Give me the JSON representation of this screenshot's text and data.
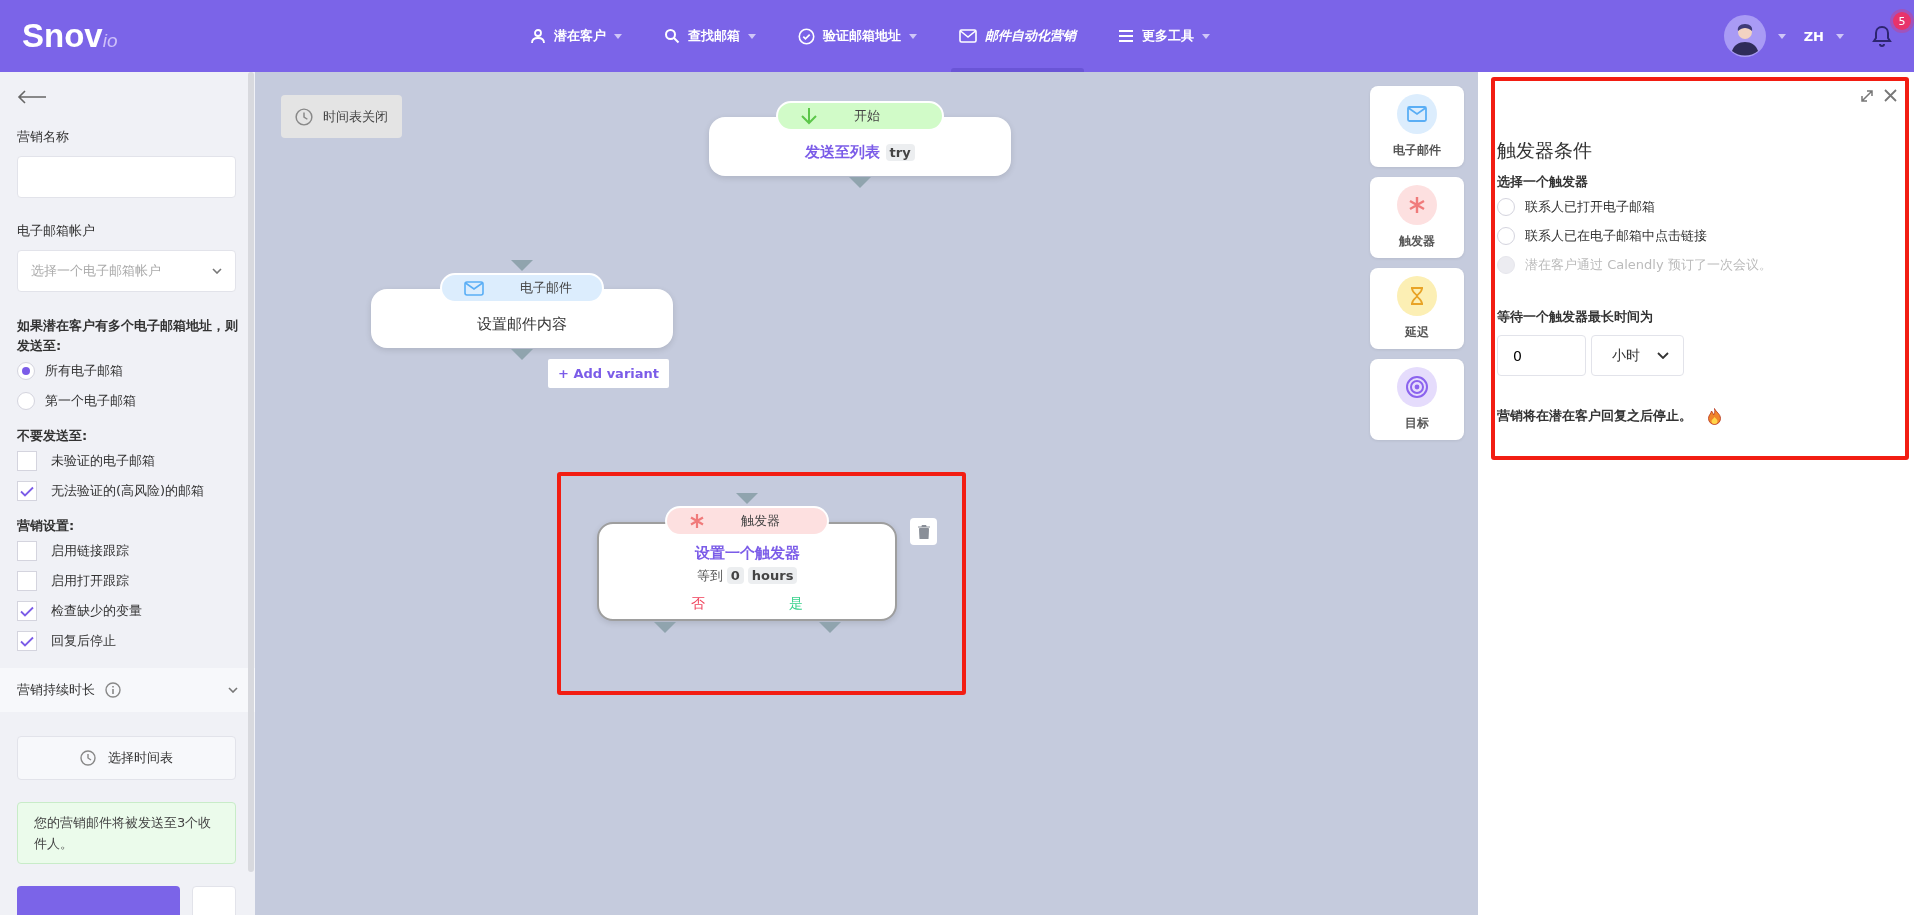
{
  "header": {
    "logo": "Snov",
    "logo_suffix": "io",
    "nav": [
      {
        "label": "潜在客户",
        "selected": false
      },
      {
        "label": "查找邮箱",
        "selected": false
      },
      {
        "label": "验证邮箱地址",
        "selected": false
      },
      {
        "label": "邮件自动化营销",
        "selected": true
      },
      {
        "label": "更多工具",
        "selected": false
      }
    ],
    "language": "ZH",
    "notifications": "5"
  },
  "sidebar": {
    "name_label": "营销名称",
    "account_label": "电子邮箱帐户",
    "account_placeholder": "选择一个电子邮箱帐户",
    "multi_label": "如果潜在客户有多个电子邮箱地址，则发送至:",
    "multi_options": [
      {
        "label": "所有电子邮箱",
        "selected": true
      },
      {
        "label": "第一个电子邮箱",
        "selected": false
      }
    ],
    "exclude_label": "不要发送至:",
    "exclude_options": [
      {
        "label": "未验证的电子邮箱",
        "checked": false
      },
      {
        "label": "无法验证的(高风险)的邮箱",
        "checked": true
      }
    ],
    "settings_label": "营销设置:",
    "settings_options": [
      {
        "label": "启用链接跟踪",
        "checked": false
      },
      {
        "label": "启用打开跟踪",
        "checked": false
      },
      {
        "label": "检查缺少的变量",
        "checked": true
      },
      {
        "label": "回复后停止",
        "checked": true
      }
    ],
    "duration_label": "营销持续时长",
    "schedule_button": "选择时间表",
    "notice": "您的营销邮件将被发送至3个收件人。"
  },
  "canvas": {
    "schedule_toggle": "时间表关闭",
    "nodes": [
      {
        "kind": "start",
        "tag": "开始",
        "title": "发送至列表",
        "badge": "try",
        "highlighted": false
      },
      {
        "kind": "email",
        "tag": "电子邮件",
        "title": "设置邮件内容",
        "add_variant": "+ Add variant",
        "highlighted": false
      },
      {
        "kind": "trigger",
        "tag": "触发器",
        "title": "设置一个触发器",
        "wait_label": "等到",
        "wait_value": "0",
        "wait_unit": "hours",
        "no": "否",
        "yes": "是",
        "highlighted": true
      }
    ],
    "tools": [
      {
        "kind": "email",
        "label": "电子邮件"
      },
      {
        "kind": "trigger",
        "label": "触发器"
      },
      {
        "kind": "delay",
        "label": "延迟"
      },
      {
        "kind": "goal",
        "label": "目标"
      }
    ]
  },
  "panel": {
    "highlighted": true,
    "title": "触发器条件",
    "choose_label": "选择一个触发器",
    "triggers": [
      {
        "label": "联系人已打开电子邮箱",
        "selected": false,
        "disabled": false
      },
      {
        "label": "联系人已在电子邮箱中点击链接",
        "selected": false,
        "disabled": false
      },
      {
        "label": "潜在客户通过 Calendly 预订了一次会议。",
        "selected": false,
        "disabled": true
      }
    ],
    "wait_label": "等待一个触发器最长时间为",
    "wait_value": "0",
    "wait_unit": "小时",
    "note": "营销将在潜在客户回复之后停止。"
  }
}
